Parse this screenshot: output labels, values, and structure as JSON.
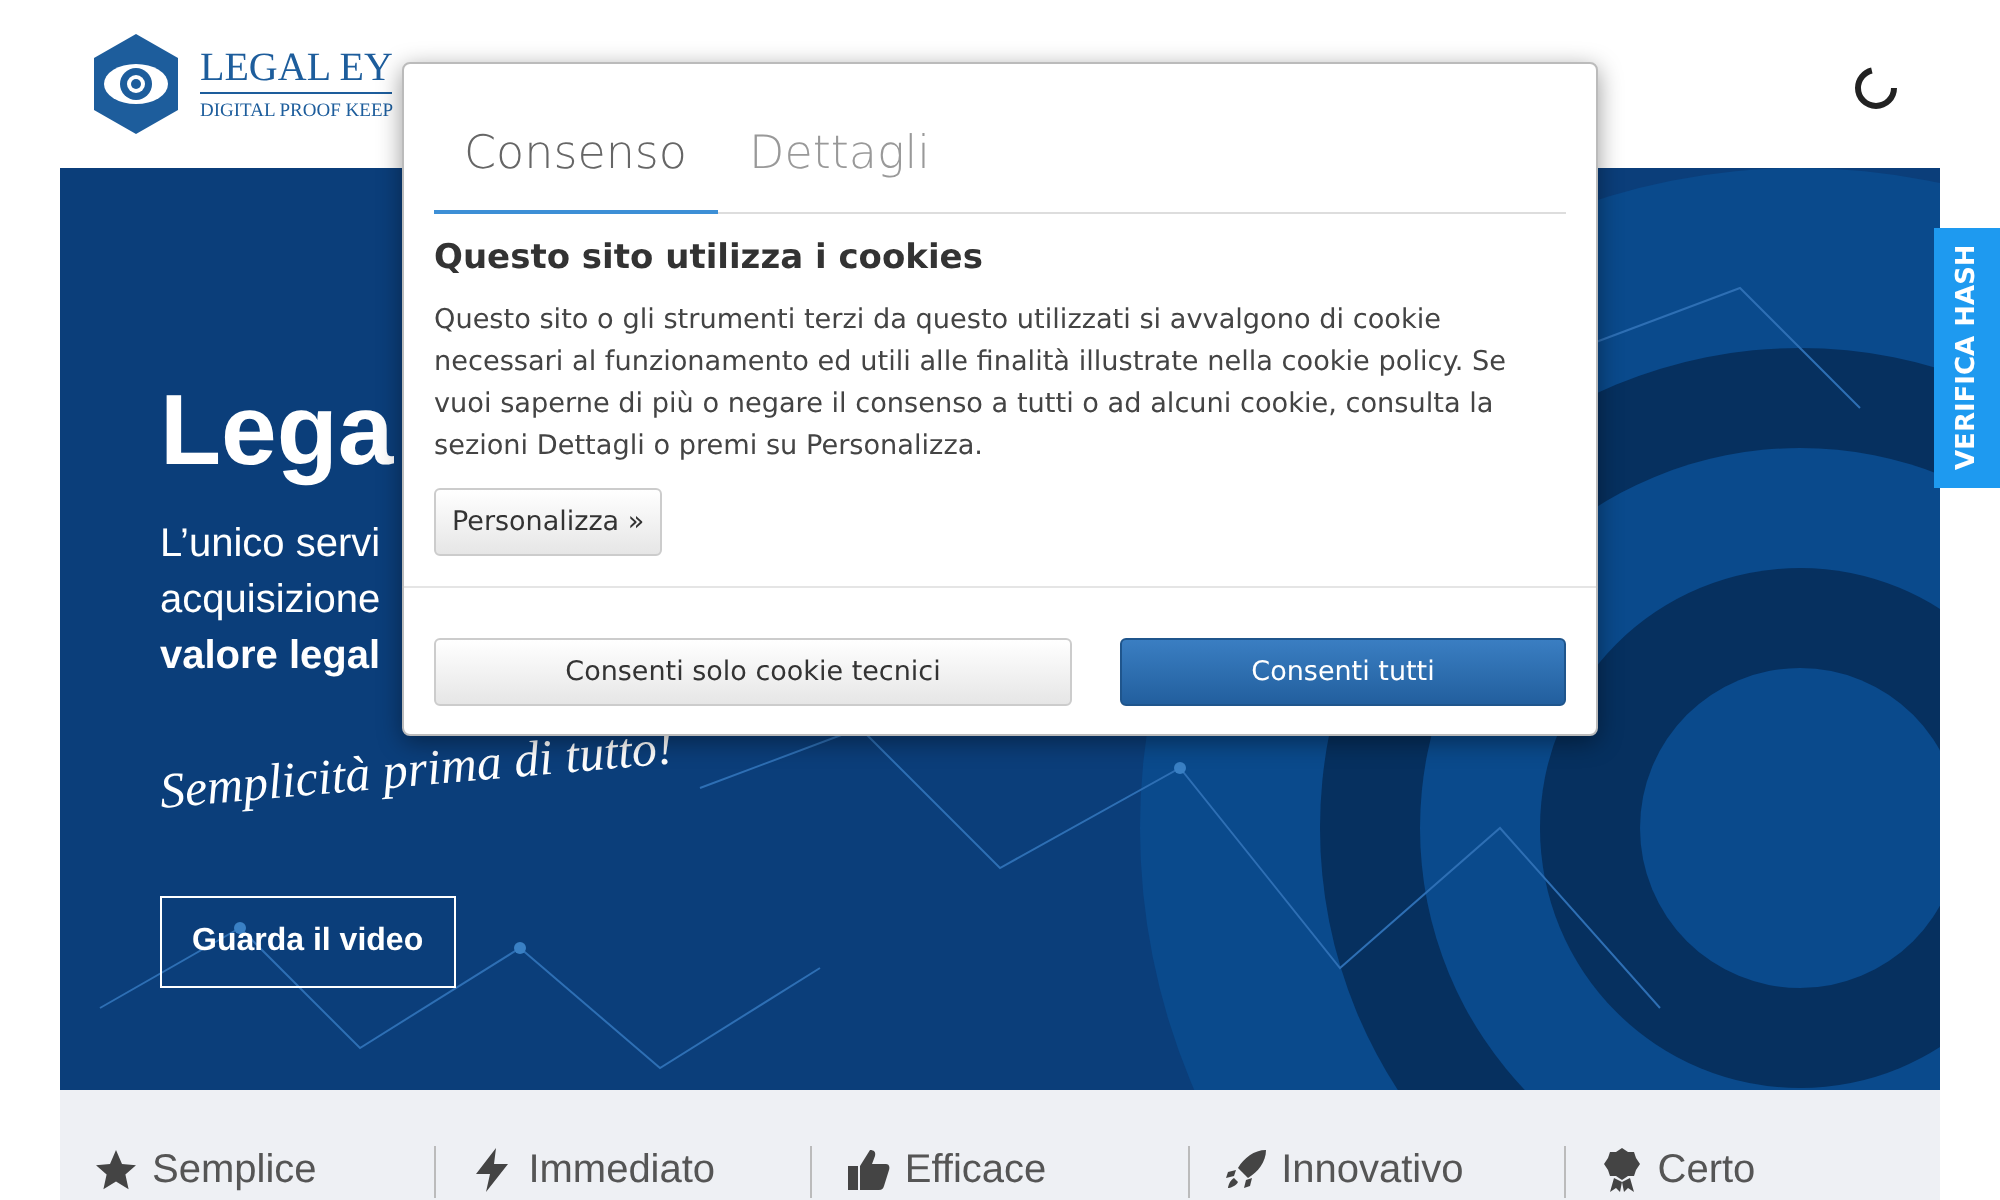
{
  "logo": {
    "name": "LEGAL EY",
    "tagline": "DIGITAL PROOF KEEP"
  },
  "hero": {
    "title": "Lega",
    "lines": [
      "L’unico servi",
      "acquisizione"
    ],
    "bold_line": "valore legal",
    "slogan": "Semplicità prima di tutto!",
    "video_button": "Guarda il video"
  },
  "side_tab": "VERIFICA HASH",
  "features": [
    "Semplice",
    "Immediato",
    "Efficace",
    "Innovativo",
    "Certo"
  ],
  "cookie_dialog": {
    "tabs": [
      {
        "label": "Consenso",
        "selected": true
      },
      {
        "label": "Dettagli",
        "selected": false
      }
    ],
    "heading": "Questo sito utilizza i cookies",
    "text": "Questo sito o gli strumenti terzi da questo utilizzati si avvalgono di cookie necessari al funzionamento ed utili alle finalità illustrate nella cookie policy. Se vuoi saperne di più o negare il consenso a tutti o ad alcuni cookie, consulta la sezioni Dettagli o premi su Personalizza.",
    "customize_button": "Personalizza »",
    "buttons": [
      {
        "label": "Consenti solo cookie tecnici",
        "kind": "secondary"
      },
      {
        "label": "Consenti tutti",
        "kind": "primary"
      }
    ]
  }
}
